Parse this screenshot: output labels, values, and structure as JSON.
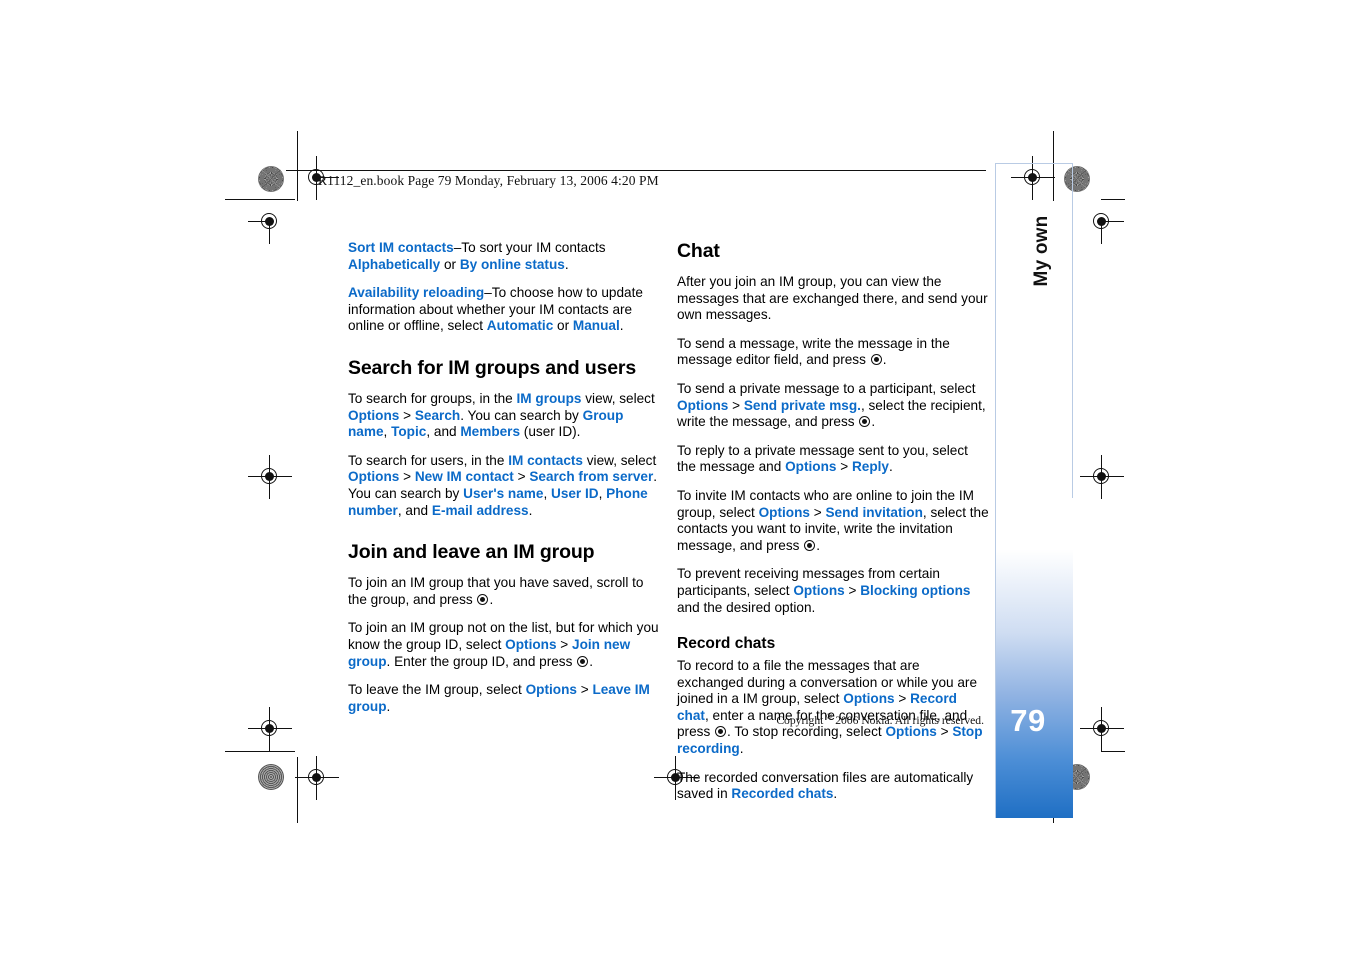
{
  "header": {
    "slug": "R1112_en.book  Page 79  Monday, February 13, 2006  4:20 PM"
  },
  "chapter_tab": {
    "label": "My own",
    "page_number": "79",
    "accent_color": "#1f6fc4"
  },
  "footer": {
    "copyright_prefix": "Copyright ",
    "copyright_symbol": "®",
    "copyright_suffix": " 2006 Nokia. All rights reserved."
  },
  "colors": {
    "ui_link": "#0b6ac8",
    "body_text": "#000000",
    "tab_border": "#b9cbe4"
  },
  "left_column": {
    "blocks": [
      {
        "type": "para",
        "name": "sort-im-contacts-paragraph",
        "runs": [
          {
            "t": "ui",
            "v": "Sort IM contacts"
          },
          {
            "t": "plain",
            "v": "–To sort your IM contacts "
          },
          {
            "t": "ui",
            "v": "Alphabetically"
          },
          {
            "t": "plain",
            "v": " or "
          },
          {
            "t": "ui",
            "v": "By online status"
          },
          {
            "t": "plain",
            "v": "."
          }
        ]
      },
      {
        "type": "para",
        "name": "availability-reloading-paragraph",
        "runs": [
          {
            "t": "ui",
            "v": "Availability reloading"
          },
          {
            "t": "plain",
            "v": "–To choose how to update information about whether your IM contacts are online or offline, select "
          },
          {
            "t": "ui",
            "v": "Automatic"
          },
          {
            "t": "plain",
            "v": " or "
          },
          {
            "t": "ui",
            "v": "Manual"
          },
          {
            "t": "plain",
            "v": "."
          }
        ]
      },
      {
        "type": "h2",
        "name": "heading-search-for-im-groups-and-users",
        "text": "Search for IM groups and users"
      },
      {
        "type": "para",
        "name": "search-groups-paragraph",
        "runs": [
          {
            "t": "plain",
            "v": "To search for groups, in the "
          },
          {
            "t": "ui",
            "v": "IM groups"
          },
          {
            "t": "plain",
            "v": " view, select "
          },
          {
            "t": "ui",
            "v": "Options"
          },
          {
            "t": "gt",
            "v": " > "
          },
          {
            "t": "ui",
            "v": "Search"
          },
          {
            "t": "plain",
            "v": ". You can search by "
          },
          {
            "t": "ui",
            "v": "Group name"
          },
          {
            "t": "plain",
            "v": ", "
          },
          {
            "t": "ui",
            "v": "Topic"
          },
          {
            "t": "plain",
            "v": ", and "
          },
          {
            "t": "ui",
            "v": "Members"
          },
          {
            "t": "plain",
            "v": " (user ID)."
          }
        ]
      },
      {
        "type": "para",
        "name": "search-users-paragraph",
        "runs": [
          {
            "t": "plain",
            "v": "To search for users, in the "
          },
          {
            "t": "ui",
            "v": "IM contacts"
          },
          {
            "t": "plain",
            "v": " view, select "
          },
          {
            "t": "ui",
            "v": "Options"
          },
          {
            "t": "gt",
            "v": " > "
          },
          {
            "t": "ui",
            "v": "New IM contact"
          },
          {
            "t": "gt",
            "v": " > "
          },
          {
            "t": "ui",
            "v": "Search from server"
          },
          {
            "t": "plain",
            "v": ". You can search by "
          },
          {
            "t": "ui",
            "v": "User's name"
          },
          {
            "t": "plain",
            "v": ", "
          },
          {
            "t": "ui",
            "v": "User ID"
          },
          {
            "t": "plain",
            "v": ", "
          },
          {
            "t": "ui",
            "v": "Phone number"
          },
          {
            "t": "plain",
            "v": ", and "
          },
          {
            "t": "ui",
            "v": "E-mail address"
          },
          {
            "t": "plain",
            "v": "."
          }
        ]
      },
      {
        "type": "h2",
        "name": "heading-join-and-leave-an-im-group",
        "text": "Join and leave an IM group"
      },
      {
        "type": "para",
        "name": "join-saved-group-paragraph",
        "runs": [
          {
            "t": "plain",
            "v": "To join an IM group that you have saved, scroll to the group, and press "
          },
          {
            "t": "key",
            "v": "select-key-icon"
          },
          {
            "t": "plain",
            "v": "."
          }
        ]
      },
      {
        "type": "para",
        "name": "join-new-group-paragraph",
        "runs": [
          {
            "t": "plain",
            "v": "To join an IM group not on the list, but for which you know the group ID, select "
          },
          {
            "t": "ui",
            "v": "Options"
          },
          {
            "t": "gt",
            "v": " > "
          },
          {
            "t": "ui",
            "v": "Join new group"
          },
          {
            "t": "plain",
            "v": ". Enter the group ID, and press "
          },
          {
            "t": "key",
            "v": "select-key-icon"
          },
          {
            "t": "plain",
            "v": "."
          }
        ]
      },
      {
        "type": "para",
        "name": "leave-group-paragraph",
        "runs": [
          {
            "t": "plain",
            "v": "To leave the IM group, select "
          },
          {
            "t": "ui",
            "v": "Options"
          },
          {
            "t": "gt",
            "v": " > "
          },
          {
            "t": "ui",
            "v": "Leave IM group"
          },
          {
            "t": "plain",
            "v": "."
          }
        ]
      }
    ]
  },
  "right_column": {
    "blocks": [
      {
        "type": "h2",
        "name": "heading-chat",
        "text": "Chat"
      },
      {
        "type": "para",
        "name": "chat-intro-paragraph",
        "runs": [
          {
            "t": "plain",
            "v": "After you join an IM group, you can view the messages that are exchanged there, and send your own messages."
          }
        ]
      },
      {
        "type": "para",
        "name": "send-message-paragraph",
        "runs": [
          {
            "t": "plain",
            "v": "To send a message, write the message in the message editor field, and press "
          },
          {
            "t": "key",
            "v": "select-key-icon"
          },
          {
            "t": "plain",
            "v": "."
          }
        ]
      },
      {
        "type": "para",
        "name": "send-private-message-paragraph",
        "runs": [
          {
            "t": "plain",
            "v": "To send a private message to a participant, select "
          },
          {
            "t": "ui",
            "v": "Options"
          },
          {
            "t": "gt",
            "v": " > "
          },
          {
            "t": "ui",
            "v": "Send private msg."
          },
          {
            "t": "plain",
            "v": ", select the recipient, write the message, and press "
          },
          {
            "t": "key",
            "v": "select-key-icon"
          },
          {
            "t": "plain",
            "v": "."
          }
        ]
      },
      {
        "type": "para",
        "name": "reply-private-message-paragraph",
        "runs": [
          {
            "t": "plain",
            "v": "To reply to a private message sent to you, select the message and "
          },
          {
            "t": "ui",
            "v": "Options"
          },
          {
            "t": "gt",
            "v": " > "
          },
          {
            "t": "ui",
            "v": "Reply"
          },
          {
            "t": "plain",
            "v": "."
          }
        ]
      },
      {
        "type": "para",
        "name": "send-invitation-paragraph",
        "runs": [
          {
            "t": "plain",
            "v": "To invite IM contacts who are online to join the IM group, select "
          },
          {
            "t": "ui",
            "v": "Options"
          },
          {
            "t": "gt",
            "v": " > "
          },
          {
            "t": "ui",
            "v": "Send invitation"
          },
          {
            "t": "plain",
            "v": ", select the contacts you want to invite, write the invitation message, and press "
          },
          {
            "t": "key",
            "v": "select-key-icon"
          },
          {
            "t": "plain",
            "v": "."
          }
        ]
      },
      {
        "type": "para",
        "name": "blocking-options-paragraph",
        "runs": [
          {
            "t": "plain",
            "v": "To prevent receiving messages from certain participants, select "
          },
          {
            "t": "ui",
            "v": "Options"
          },
          {
            "t": "gt",
            "v": " > "
          },
          {
            "t": "ui",
            "v": "Blocking options"
          },
          {
            "t": "plain",
            "v": " and the desired option."
          }
        ]
      },
      {
        "type": "h3",
        "name": "heading-record-chats",
        "text": "Record chats"
      },
      {
        "type": "para",
        "name": "record-chat-paragraph",
        "runs": [
          {
            "t": "plain",
            "v": "To record to a file the messages that are exchanged during a conversation or while you are joined in a IM group, select "
          },
          {
            "t": "ui",
            "v": "Options"
          },
          {
            "t": "gt",
            "v": " > "
          },
          {
            "t": "ui",
            "v": "Record chat"
          },
          {
            "t": "plain",
            "v": ", enter a name for the conversation file, and press "
          },
          {
            "t": "key",
            "v": "select-key-icon"
          },
          {
            "t": "plain",
            "v": ". To stop recording, select "
          },
          {
            "t": "ui",
            "v": "Options"
          },
          {
            "t": "gt",
            "v": " > "
          },
          {
            "t": "ui",
            "v": "Stop recording"
          },
          {
            "t": "plain",
            "v": "."
          }
        ]
      },
      {
        "type": "para",
        "name": "recorded-chats-paragraph",
        "runs": [
          {
            "t": "plain",
            "v": "The recorded conversation files are automatically saved in "
          },
          {
            "t": "ui",
            "v": "Recorded chats"
          },
          {
            "t": "plain",
            "v": "."
          }
        ]
      }
    ]
  }
}
